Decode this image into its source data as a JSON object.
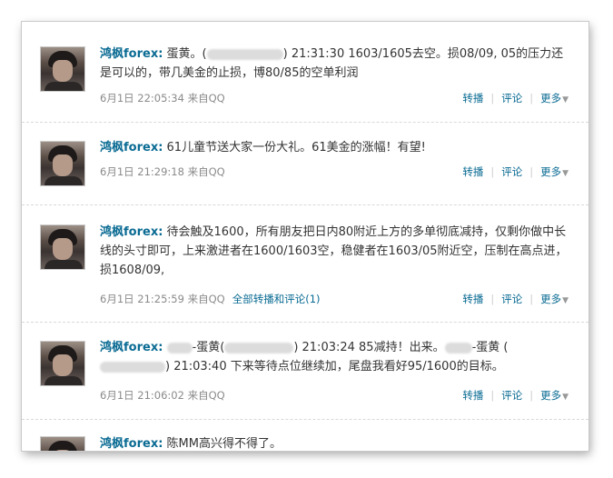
{
  "posts": [
    {
      "author": "鸿枫forex:",
      "text_a": " 蛋黄。(",
      "text_b": ") 21:31:30 1603/1605去空。损08/09,   05的压力还是可以的，带几美金的止损，博80/85的空单利润",
      "time": "6月1日 22:05:34 来自QQ"
    },
    {
      "author": "鸿枫forex:",
      "text": " 61儿童节送大家一份大礼。61美金的涨幅！有望!",
      "time": "6月1日 21:29:18 来自QQ"
    },
    {
      "author": "鸿枫forex:",
      "text": " 待会触及1600，所有朋友把日内80附近上方的多单彻底减持，仅剩你做中长线的头寸即可，上来激进者在1600/1603空，稳健者在1603/05附近空，压制在高点进，损1608/09,",
      "time": "6月1日 21:25:59 来自QQ",
      "all_link": "全部转播和评论(1)"
    },
    {
      "author": "鸿枫forex:",
      "text_a": " ",
      "text_b": "-蛋黄(",
      "text_c": ") 21:03:24 85减持！出来。",
      "text_d": "-蛋黄 (",
      "text_e": ") 21:03:40 下来等待点位继续加，尾盘我看好95/1600的目标。",
      "time": "6月1日 21:06:02 来自QQ"
    },
    {
      "author": "鸿枫forex:",
      "text": " 陈MM高兴得不得了。"
    }
  ],
  "actions": {
    "forward": "转播",
    "comment": "评论",
    "more": "更多"
  }
}
